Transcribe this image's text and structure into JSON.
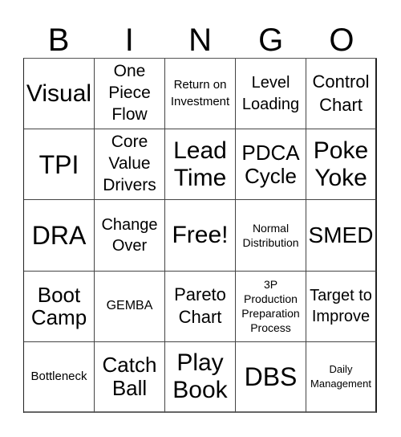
{
  "header": {
    "letters": [
      "B",
      "I",
      "N",
      "G",
      "O"
    ]
  },
  "cells": [
    "Visual",
    "One Piece Flow",
    "Return on Investment",
    "Level Loading",
    "Control Chart",
    "TPI",
    "Core Value Drivers",
    "Lead Time",
    "PDCA Cycle",
    "Poke Yoke",
    "DRA",
    "Change Over",
    "Free!",
    "Normal Distribution",
    "SMED",
    "Boot Camp",
    "GEMBA",
    "Pareto Chart",
    "3P Production Preparation Process",
    "Target to Improve",
    "Bottleneck",
    "Catch Ball",
    "Play Book",
    "DBS",
    "Daily Management"
  ]
}
